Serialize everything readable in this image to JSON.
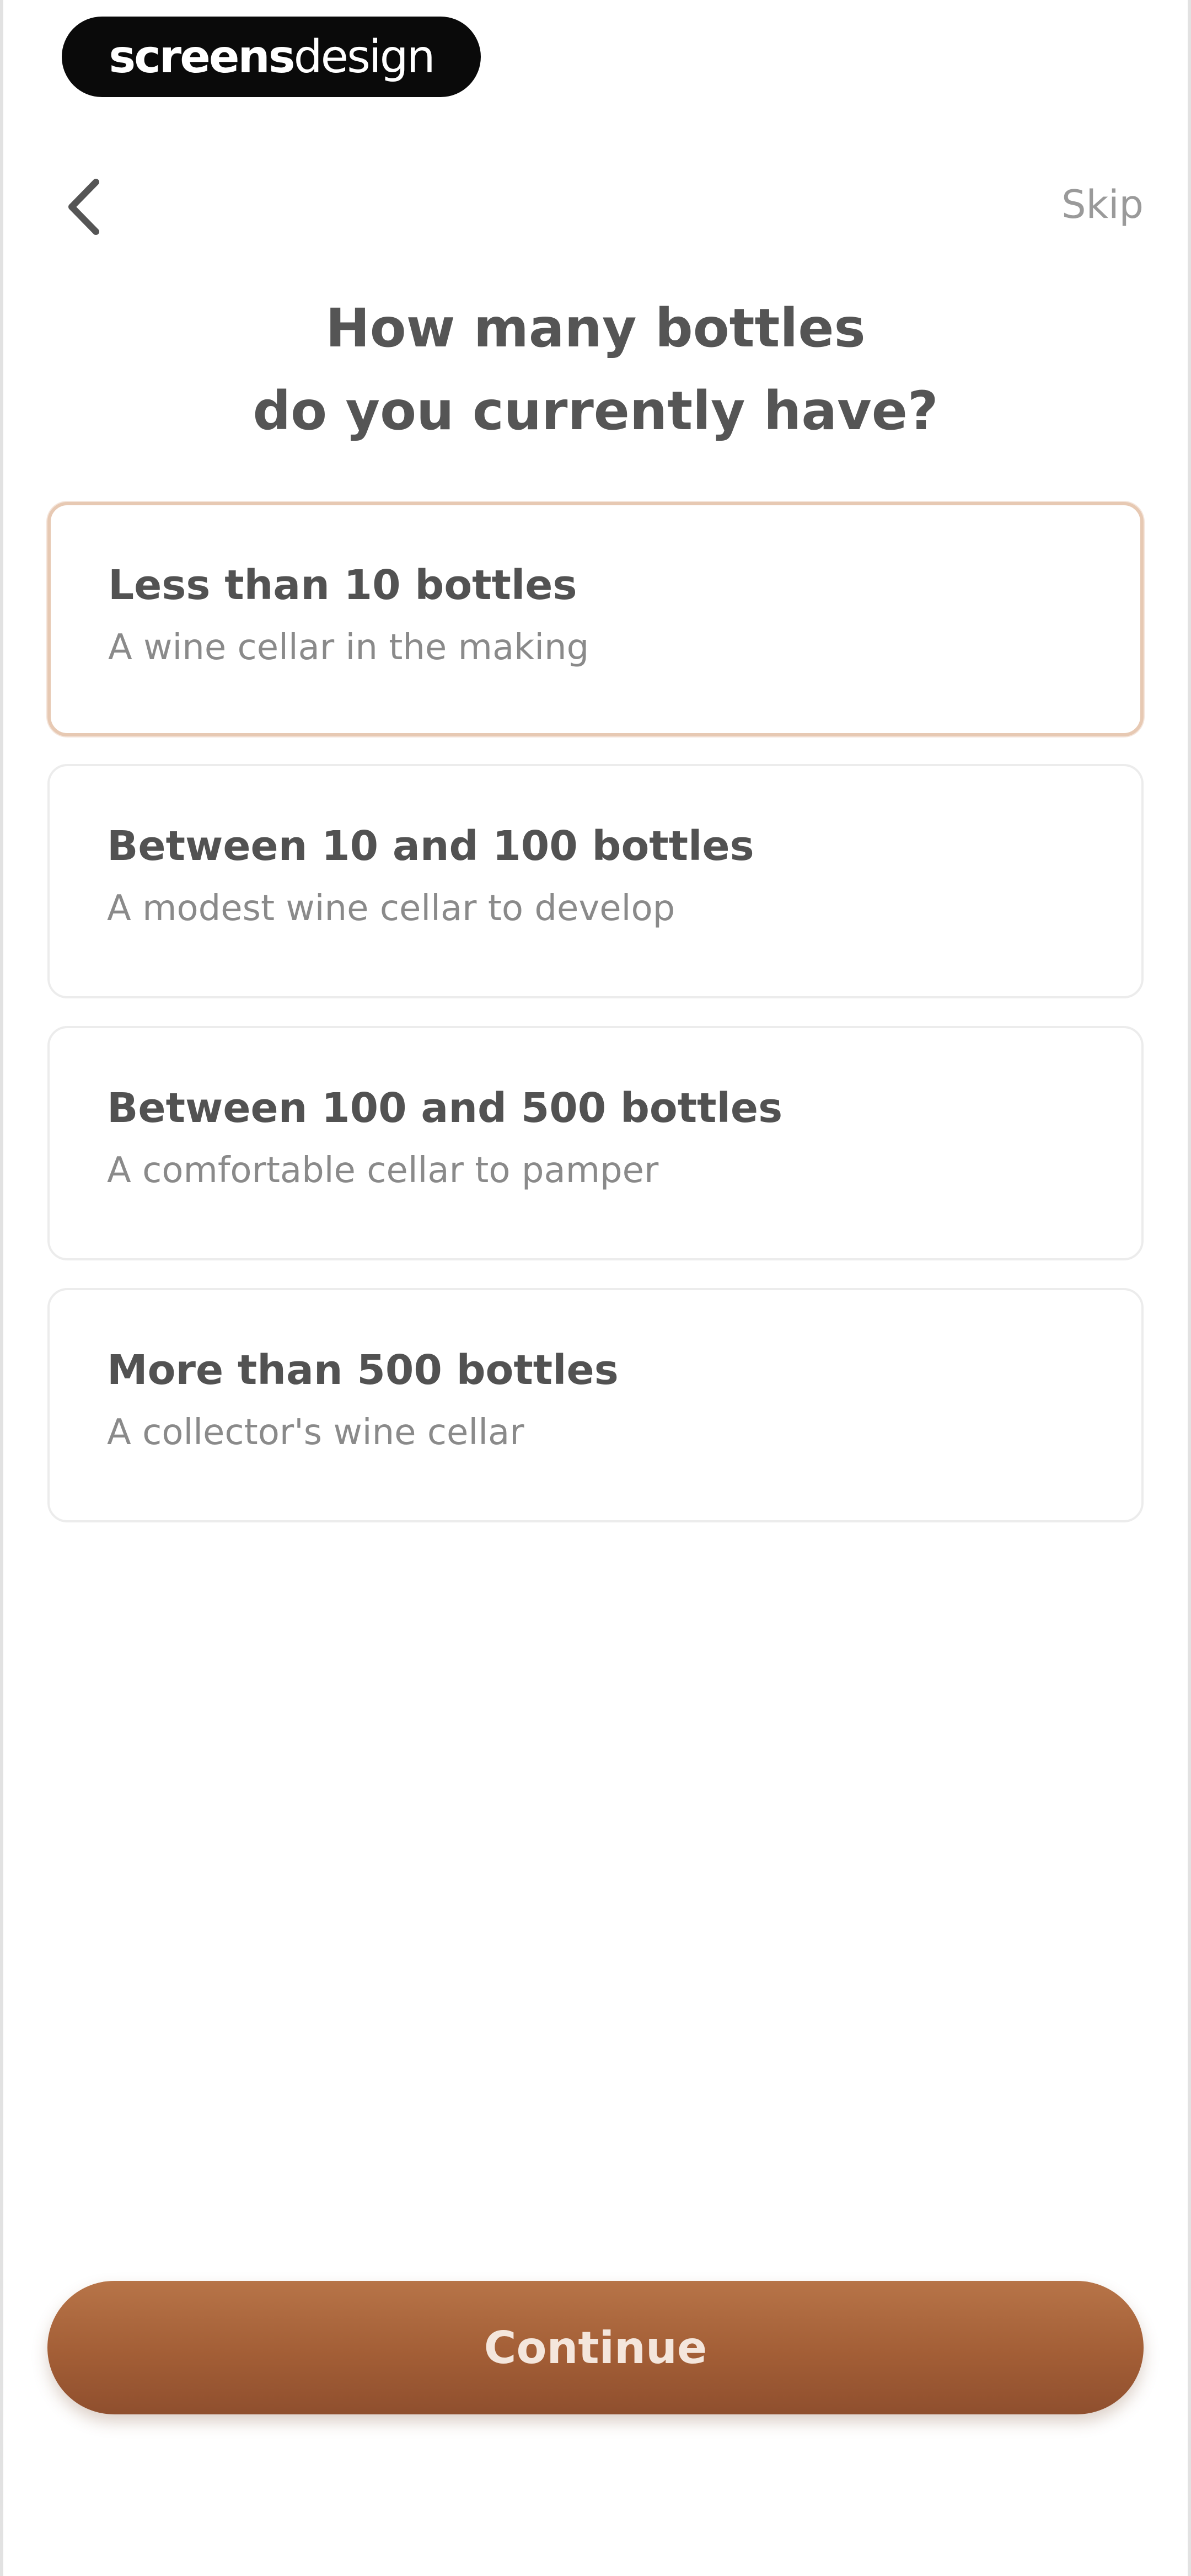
{
  "brand": {
    "strong": "screens",
    "light": "design"
  },
  "header": {
    "back_icon": "chevron-left-icon",
    "skip_label": "Skip"
  },
  "question": {
    "line1": "How many bottles",
    "line2": "do you currently have?"
  },
  "options": [
    {
      "title": "Less than 10 bottles",
      "subtitle": "A wine cellar in the making",
      "selected": true
    },
    {
      "title": "Between 10 and 100 bottles",
      "subtitle": "A modest wine cellar to develop",
      "selected": false
    },
    {
      "title": "Between 100 and 500 bottles",
      "subtitle": "A comfortable cellar to pamper",
      "selected": false
    },
    {
      "title": "More than 500 bottles",
      "subtitle": "A collector's wine cellar",
      "selected": false
    }
  ],
  "footer": {
    "continue_label": "Continue"
  },
  "colors": {
    "accent": "#a35e36",
    "selected_border": "#e7c9b3"
  }
}
